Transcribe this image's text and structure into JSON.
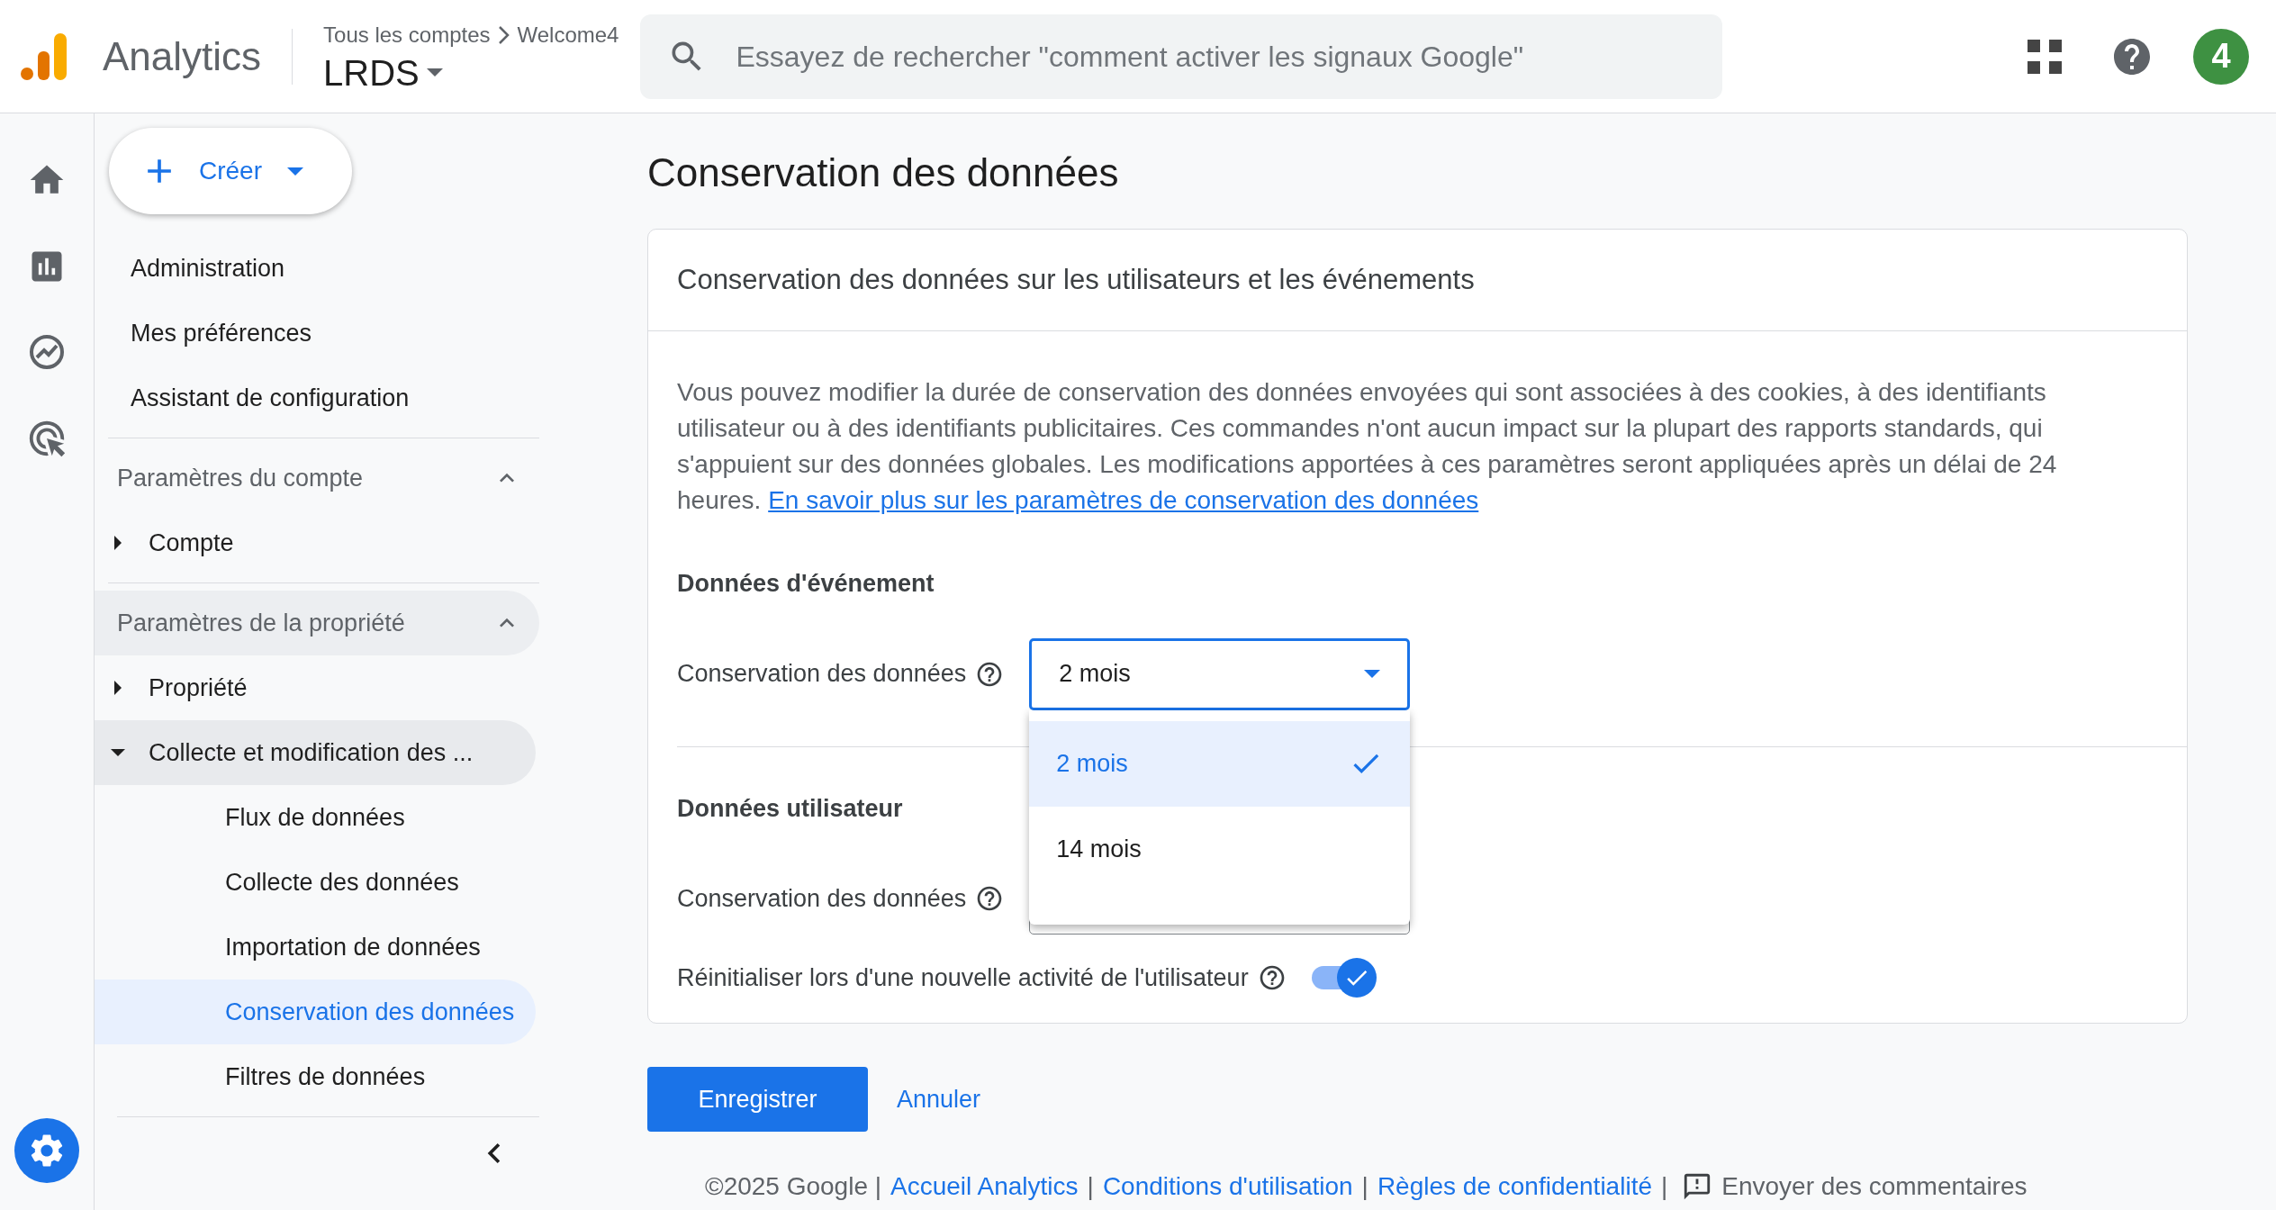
{
  "header": {
    "product": "Analytics",
    "breadcrumb": [
      "Tous les comptes",
      "Welcome4"
    ],
    "property": "LRDS",
    "search": {
      "placeholder": "Essayez de rechercher \"comment activer les signaux Google\""
    },
    "avatar": "4"
  },
  "create_button": "Créer",
  "nav": [
    {
      "kind": "item",
      "label": "Administration"
    },
    {
      "kind": "item",
      "label": "Mes préférences"
    },
    {
      "kind": "item",
      "label": "Assistant de configuration"
    },
    {
      "kind": "section",
      "label": "Paramètres du compte",
      "expanded": true,
      "hovered": false,
      "children": [
        {
          "label": "Compte",
          "expanded": false
        }
      ]
    },
    {
      "kind": "section",
      "label": "Paramètres de la propriété",
      "expanded": true,
      "hovered": true,
      "children": [
        {
          "label": "Propriété",
          "expanded": false
        },
        {
          "label": "Collecte et modification des ...",
          "expanded": true,
          "children": [
            {
              "label": "Flux de données",
              "selected": false
            },
            {
              "label": "Collecte des données",
              "selected": false
            },
            {
              "label": "Importation de données",
              "selected": false
            },
            {
              "label": "Conservation des données",
              "selected": true
            },
            {
              "label": "Filtres de données",
              "selected": false
            }
          ]
        }
      ]
    }
  ],
  "page_title": "Conservation des données",
  "card": {
    "title": "Conservation des données sur les utilisateurs et les événements",
    "description": "Vous pouvez modifier la durée de conservation des données envoyées qui sont associées à des cookies, à des identifiants utilisateur ou à des identifiants publicitaires. Ces commandes n'ont aucun impact sur la plupart des rapports standards, qui s'appuient sur des données globales. Les modifications apportées à ces paramètres seront appliquées après un délai de 24 heures.",
    "link": "En savoir plus sur les paramètres de conservation des données",
    "event_data": {
      "heading": "Données d'événement",
      "label": "Conservation des données",
      "value": "2 mois",
      "open": true,
      "options": [
        {
          "label": "2 mois",
          "selected": true
        },
        {
          "label": "14 mois",
          "selected": false
        }
      ]
    },
    "user_data": {
      "heading": "Données utilisateur",
      "label": "Conservation des données"
    },
    "reset": {
      "label": "Réinitialiser lors d'une nouvelle activité de l'utilisateur",
      "on": true
    }
  },
  "actions": {
    "save": "Enregistrer",
    "cancel": "Annuler"
  },
  "footer": [
    {
      "kind": "text",
      "text": "©2025 Google |"
    },
    {
      "kind": "link",
      "text": "Accueil Analytics"
    },
    {
      "kind": "text",
      "text": "|"
    },
    {
      "kind": "link",
      "text": "Conditions d'utilisation"
    },
    {
      "kind": "text",
      "text": "|"
    },
    {
      "kind": "link",
      "text": "Règles de confidentialité"
    },
    {
      "kind": "text",
      "text": "|"
    },
    {
      "kind": "feedback",
      "text": "Envoyer des commentaires"
    }
  ]
}
